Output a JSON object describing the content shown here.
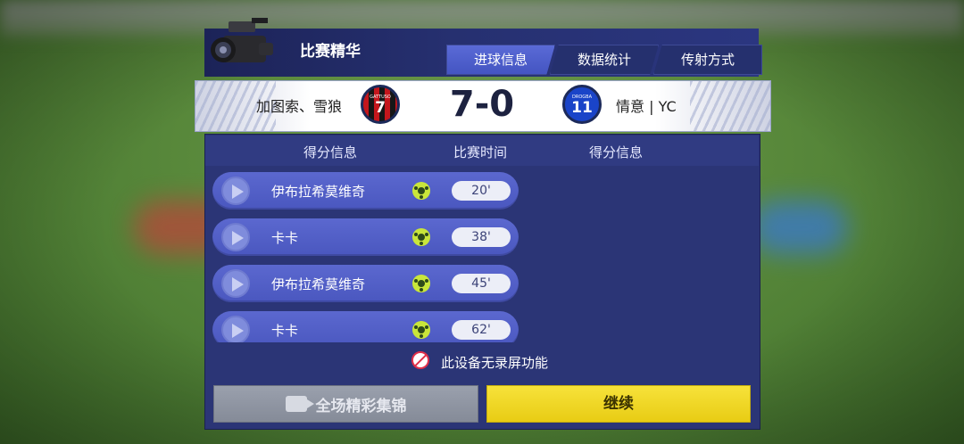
{
  "header": {
    "title": "比赛精华"
  },
  "tabs": [
    {
      "label": "进球信息",
      "active": true
    },
    {
      "label": "数据统计",
      "active": false
    },
    {
      "label": "传射方式",
      "active": false
    }
  ],
  "match": {
    "home_team": "加图索、雪狼",
    "away_team": "情意 | YC",
    "score": "7-0",
    "home_jersey": {
      "name": "GATTUSO",
      "number": "7"
    },
    "away_jersey": {
      "name": "DROGBA",
      "number": "11"
    }
  },
  "columns": {
    "left": "得分信息",
    "middle": "比赛时间",
    "right": "得分信息"
  },
  "goals": [
    {
      "player": "伊布拉希莫维奇",
      "time": "20'"
    },
    {
      "player": "卡卡",
      "time": "38'"
    },
    {
      "player": "伊布拉希莫维奇",
      "time": "45'"
    },
    {
      "player": "卡卡",
      "time": "62'"
    }
  ],
  "notice": "此设备无录屏功能",
  "buttons": {
    "highlights": "全场精彩集锦",
    "continue": "继续"
  },
  "colors": {
    "accent": "#4455c2",
    "continue": "#f0d820",
    "panel": "#2b3576"
  },
  "icons": [
    "camera-icon",
    "play-icon",
    "soccer-ball-icon",
    "no-record-icon",
    "video-camera-icon"
  ]
}
